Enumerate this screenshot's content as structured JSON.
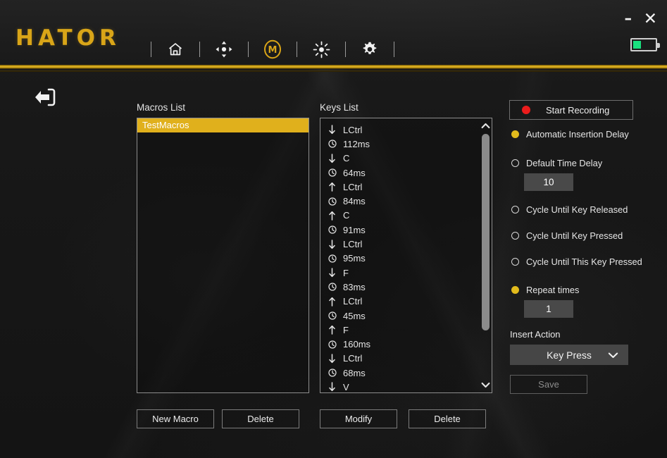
{
  "app": {
    "brand": "HATOR",
    "nav": [
      {
        "name": "home-icon",
        "label": "Home",
        "active": false
      },
      {
        "name": "dpi-icon",
        "label": "DPI",
        "active": false
      },
      {
        "name": "macro-icon",
        "label": "Macro",
        "active": true
      },
      {
        "name": "lighting-icon",
        "label": "Lighting",
        "active": false
      },
      {
        "name": "settings-icon",
        "label": "Settings",
        "active": false
      }
    ],
    "window": {
      "minimize": "–",
      "close": "✕"
    },
    "battery": {
      "level_percent": 35,
      "color": "#19e07e"
    },
    "accent_gold": "#d9a518",
    "back_label": "Back"
  },
  "macros": {
    "label": "Macros List",
    "items": [
      {
        "name": "TestMacros",
        "selected": true
      }
    ],
    "buttons": {
      "new": "New Macro",
      "delete": "Delete"
    }
  },
  "keys": {
    "label": "Keys List",
    "items": [
      {
        "type": "press",
        "value": "LCtrl"
      },
      {
        "type": "delay",
        "value": "112ms"
      },
      {
        "type": "press",
        "value": "C"
      },
      {
        "type": "delay",
        "value": "64ms"
      },
      {
        "type": "release",
        "value": "LCtrl"
      },
      {
        "type": "delay",
        "value": "84ms"
      },
      {
        "type": "release",
        "value": "C"
      },
      {
        "type": "delay",
        "value": "91ms"
      },
      {
        "type": "press",
        "value": "LCtrl"
      },
      {
        "type": "delay",
        "value": "95ms"
      },
      {
        "type": "press",
        "value": "F"
      },
      {
        "type": "delay",
        "value": "83ms"
      },
      {
        "type": "release",
        "value": "LCtrl"
      },
      {
        "type": "delay",
        "value": "45ms"
      },
      {
        "type": "release",
        "value": "F"
      },
      {
        "type": "delay",
        "value": "160ms"
      },
      {
        "type": "press",
        "value": "LCtrl"
      },
      {
        "type": "delay",
        "value": "68ms"
      },
      {
        "type": "press",
        "value": "V"
      }
    ],
    "buttons": {
      "modify": "Modify",
      "delete": "Delete"
    },
    "scrollbar": {
      "up": "∧",
      "down": "∨"
    }
  },
  "panel": {
    "record_button": "Start Recording",
    "options": [
      {
        "label": "Automatic Insertion Delay",
        "selected": true
      },
      {
        "label": "Default Time Delay",
        "selected": false
      },
      {
        "label": "Cycle Until Key Released",
        "selected": false
      },
      {
        "label": "Cycle Until Key Pressed",
        "selected": false
      },
      {
        "label": "Cycle Until This Key Pressed",
        "selected": false
      },
      {
        "label": "Repeat times",
        "selected": true
      }
    ],
    "default_time_delay_value": "10",
    "repeat_times_value": "1",
    "insert_action_label": "Insert Action",
    "insert_action_value": "Key Press",
    "save_label": "Save"
  }
}
